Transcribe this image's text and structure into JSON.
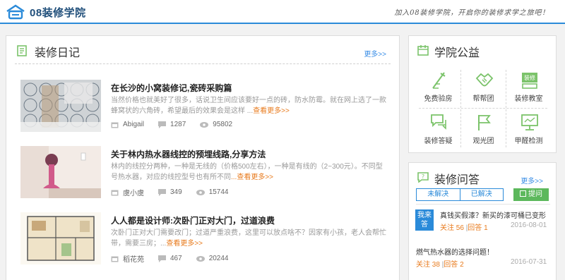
{
  "header": {
    "logo_text": "08装修学院",
    "slogan": "加入08装修学院，开启你的装修求学之旅吧！"
  },
  "diary": {
    "title": "装修日记",
    "more": "更多>>",
    "articles": [
      {
        "title": "在长沙的小窝装修记,瓷砖采购篇",
        "desc": "当然价格也就美好了很多，话说卫生间应该要好一点的砖，防水防霉。就在网上选了一款蜂窝状的六角砖，希望最后的效果会是这样 ...",
        "readmore": "查看更多>>",
        "author": "Abigail",
        "comments": "1287",
        "views": "95802"
      },
      {
        "title": "关于林内热水器线控的预埋线路,分享方法",
        "desc": "林内的线控分两种，一种是无线的（价格500左右），一种是有线的（2~300元）。不同型号热水器，对应的线控型号也有所不同",
        "readmore": "...查看更多>>",
        "author": "虞小虞",
        "comments": "349",
        "views": "15744"
      },
      {
        "title": "人人都是设计师:次卧门正对大门，过道浪费",
        "desc": "次卧门正对大门需要改门；过道严重浪费，这里可以放点啥不？因家有小孩，老人会帮忙带，需要三房；...",
        "readmore": "查看更多>>",
        "author": "稻花苑",
        "comments": "467",
        "views": "20244"
      }
    ]
  },
  "notice": {
    "title": "学院公益",
    "items": [
      {
        "label": "免费验房",
        "icon": "ruler-icon"
      },
      {
        "label": "帮帮团",
        "icon": "handshake-icon"
      },
      {
        "label": "装修教室",
        "icon": "classroom-board-icon"
      },
      {
        "label": "装修答疑",
        "icon": "chat-bubbles-icon"
      },
      {
        "label": "观光团",
        "icon": "flag-icon"
      },
      {
        "label": "甲醛检测",
        "icon": "monitor-icon"
      }
    ]
  },
  "qa": {
    "title": "装修问答",
    "more": "更多>>",
    "tab_unsolved": "未解决",
    "tab_solved": "已解决",
    "ask_label": "提问",
    "badge": "我来答",
    "questions": [
      {
        "title": "真钱买假漆？新买的漆可桶已变形",
        "follow_label": "关注",
        "follows": "56",
        "answer_label": "回答",
        "answers": "1",
        "date": "2016-08-01"
      },
      {
        "title": "燃气热水器的选择问题！",
        "follow_label": "关注",
        "follows": "38",
        "answer_label": "回答",
        "answers": "2",
        "date": "2016-07-31"
      }
    ]
  },
  "colors": {
    "accent": "#2a8ad9",
    "link_orange": "#e87b1e",
    "green": "#5cb85c"
  }
}
